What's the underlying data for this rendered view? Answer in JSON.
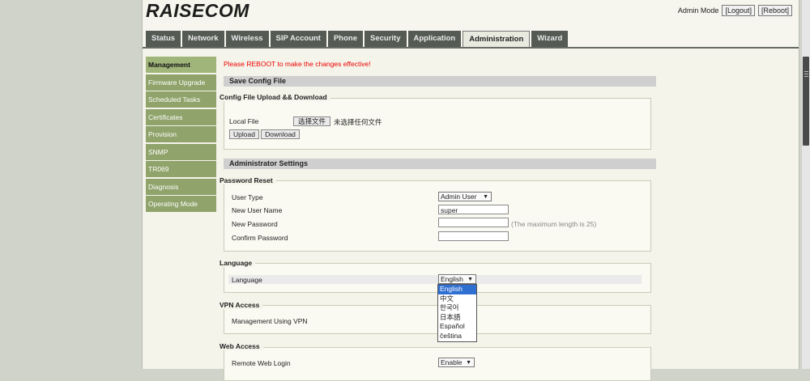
{
  "header": {
    "logo": "RAISECOM",
    "mode": "Admin Mode",
    "logout": "[Logout]",
    "reboot": "[Reboot]"
  },
  "tabs": [
    {
      "label": "Status"
    },
    {
      "label": "Network"
    },
    {
      "label": "Wireless"
    },
    {
      "label": "SIP Account"
    },
    {
      "label": "Phone"
    },
    {
      "label": "Security"
    },
    {
      "label": "Application"
    },
    {
      "label": "Administration"
    },
    {
      "label": "Wizard"
    }
  ],
  "sidebar": [
    {
      "label": "Management"
    },
    {
      "label": "Firmware Upgrade"
    },
    {
      "label": "Scheduled Tasks"
    },
    {
      "label": "Certificates"
    },
    {
      "label": "Provision"
    },
    {
      "label": "SNMP"
    },
    {
      "label": "TR069"
    },
    {
      "label": "Diagnosis"
    },
    {
      "label": "Operating Mode"
    }
  ],
  "notice": "Please REBOOT to make the changes effective!",
  "save_config": {
    "title": "Save Config File",
    "legend": "Config File Upload && Download",
    "local_file_label": "Local File",
    "choose_button": "选择文件",
    "no_file": "未选择任何文件",
    "upload": "Upload",
    "download": "Download"
  },
  "admin": {
    "title": "Administrator Settings",
    "password_legend": "Password Reset",
    "user_type_label": "User Type",
    "user_type_value": "Admin User",
    "new_user_label": "New User Name",
    "new_user_value": "super",
    "new_password_label": "New Password",
    "max_length_hint": "(The maximum length is 25)",
    "confirm_password_label": "Confirm Password"
  },
  "language": {
    "legend": "Language",
    "label": "Language",
    "value": "English",
    "options": [
      "English",
      "中文",
      "한국어",
      "日本語",
      "Español",
      "čeština"
    ]
  },
  "vpn": {
    "legend": "VPN Access",
    "label": "Management Using VPN"
  },
  "web": {
    "legend": "Web Access",
    "label": "Remote Web Login",
    "value": "Enable"
  }
}
